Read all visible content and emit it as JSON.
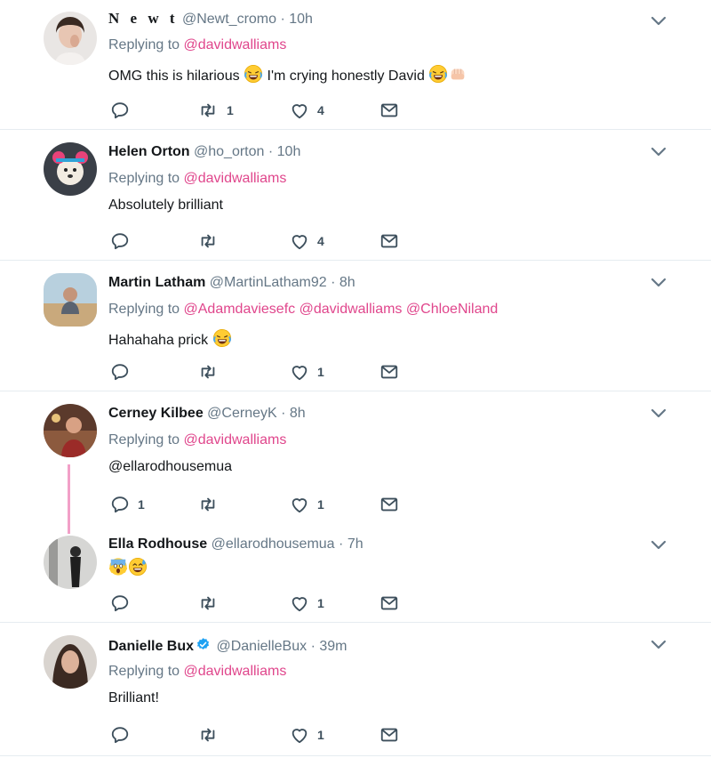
{
  "tweets": [
    {
      "display_name": "N e w t",
      "handle": "@Newt_cromo",
      "dot": "·",
      "time": "10h",
      "replying_prefix": "Replying to",
      "mentions": [
        "@davidwalliams"
      ],
      "text": "OMG this is hilarious",
      "text2": " I'm crying honestly David ",
      "reply_count": "",
      "retweet_count": "1",
      "like_count": "4"
    },
    {
      "display_name": "Helen Orton",
      "handle": "@ho_orton",
      "dot": "·",
      "time": "10h",
      "replying_prefix": "Replying to",
      "mentions": [
        "@davidwalliams"
      ],
      "text": "Absolutely brilliant",
      "reply_count": "",
      "retweet_count": "",
      "like_count": "4"
    },
    {
      "display_name": "Martin Latham",
      "handle": "@MartinLatham92",
      "dot": "·",
      "time": "8h",
      "replying_prefix": "Replying to",
      "mentions": [
        "@Adamdaviesefc",
        "@davidwalliams",
        "@ChloeNiland"
      ],
      "text": "Hahahaha prick ",
      "reply_count": "",
      "retweet_count": "",
      "like_count": "1"
    },
    {
      "display_name": "Cerney Kilbee",
      "handle": "@CerneyK",
      "dot": "·",
      "time": "8h",
      "replying_prefix": "Replying to",
      "mentions": [
        "@davidwalliams"
      ],
      "text": "@ellarodhousemua",
      "reply_count": "1",
      "retweet_count": "",
      "like_count": "1"
    },
    {
      "display_name": "Ella Rodhouse",
      "handle": "@ellarodhousemua",
      "dot": "·",
      "time": "7h",
      "text": "",
      "reply_count": "",
      "retweet_count": "",
      "like_count": "1"
    },
    {
      "display_name": "Danielle Bux",
      "handle": "@DanielleBux",
      "dot": "·",
      "time": "39m",
      "replying_prefix": "Replying to",
      "mentions": [
        "@davidwalliams"
      ],
      "text": "Brilliant!",
      "reply_count": "",
      "retweet_count": "",
      "like_count": "1",
      "verified": true
    }
  ],
  "colors": {
    "mention": "#e0468c",
    "muted": "#657786",
    "icon": "#3d4f5c",
    "separator": "#e6ecf0",
    "thread_line": "#f2a0c8",
    "verified": "#1da1f2"
  },
  "icons": [
    "reply-icon",
    "retweet-icon",
    "like-icon",
    "dm-icon",
    "caret-down-icon",
    "verified-badge-icon"
  ]
}
